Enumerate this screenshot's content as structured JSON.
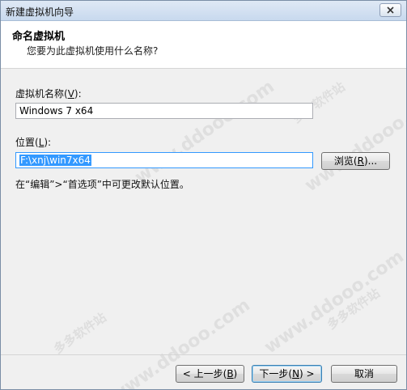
{
  "window": {
    "title": "新建虚拟机向导"
  },
  "header": {
    "title": "命名虚拟机",
    "subtitle": "您要为此虚拟机使用什么名称?"
  },
  "form": {
    "name_label_prefix": "虚拟机名称(",
    "name_label_key": "V",
    "name_label_suffix": "):",
    "name_value": "Windows 7 x64",
    "location_label_prefix": "位置(",
    "location_label_key": "L",
    "location_label_suffix": "):",
    "location_value": "F:\\xnj\\win7x64",
    "browse_prefix": "浏览(",
    "browse_key": "R",
    "browse_suffix": ")...",
    "hint": "在“编辑”>“首选项”中可更改默认位置。"
  },
  "footer": {
    "back_prefix": "< 上一步(",
    "back_key": "B",
    "back_suffix": ")",
    "next_prefix": "下一步(",
    "next_key": "N",
    "next_suffix": ") >",
    "cancel": "取消"
  },
  "watermark": {
    "url": "www.ddooo.com",
    "cn": "多多软件站"
  }
}
